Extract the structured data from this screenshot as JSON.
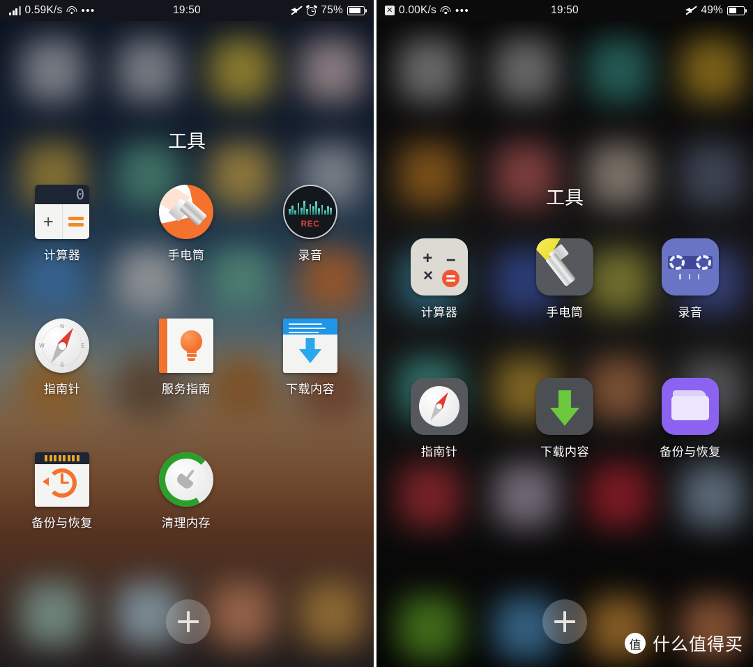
{
  "left_phone": {
    "status_bar": {
      "network_speed": "0.59K/s",
      "time": "19:50",
      "battery_percent": "75%",
      "icons": [
        "signal-bars-icon",
        "wifi-icon",
        "more-dots-icon",
        "mute-icon",
        "alarm-icon",
        "battery-icon"
      ]
    },
    "folder": {
      "title": "工具",
      "apps": [
        {
          "label": "计算器",
          "icon": "calculator-icon"
        },
        {
          "label": "手电筒",
          "icon": "flashlight-icon"
        },
        {
          "label": "录音",
          "icon": "recorder-icon",
          "screen_text": "REC"
        },
        {
          "label": "指南针",
          "icon": "compass-icon",
          "dial_labels": [
            "N",
            "S",
            "W",
            "E"
          ]
        },
        {
          "label": "服务指南",
          "icon": "service-guide-icon"
        },
        {
          "label": "下载内容",
          "icon": "download-icon"
        },
        {
          "label": "备份与恢复",
          "icon": "backup-restore-icon"
        },
        {
          "label": "清理内存",
          "icon": "clean-memory-icon"
        }
      ],
      "calculator_display": "0",
      "add_button_label": "+"
    }
  },
  "right_phone": {
    "status_bar": {
      "network_speed": "0.00K/s",
      "time": "19:50",
      "battery_percent": "49%",
      "icons": [
        "no-signal-icon",
        "wifi-icon",
        "more-dots-icon",
        "mute-icon",
        "battery-icon"
      ]
    },
    "folder": {
      "title": "工具",
      "apps": [
        {
          "label": "计算器",
          "icon": "calculator-icon",
          "symbols": [
            "+",
            "−",
            "×",
            "="
          ]
        },
        {
          "label": "手电筒",
          "icon": "flashlight-icon"
        },
        {
          "label": "录音",
          "icon": "recorder-icon"
        },
        {
          "label": "指南针",
          "icon": "compass-icon"
        },
        {
          "label": "下载内容",
          "icon": "download-icon"
        },
        {
          "label": "备份与恢复",
          "icon": "folder-backup-icon"
        }
      ],
      "add_button_label": "+"
    }
  },
  "watermark": {
    "badge": "值",
    "text": "什么值得买"
  },
  "colors": {
    "accent_orange": "#f4712e",
    "accent_blue": "#2196e8",
    "accent_green": "#6cc83c",
    "accent_purple": "#8b63f0",
    "rec_red": "#d8423a"
  }
}
